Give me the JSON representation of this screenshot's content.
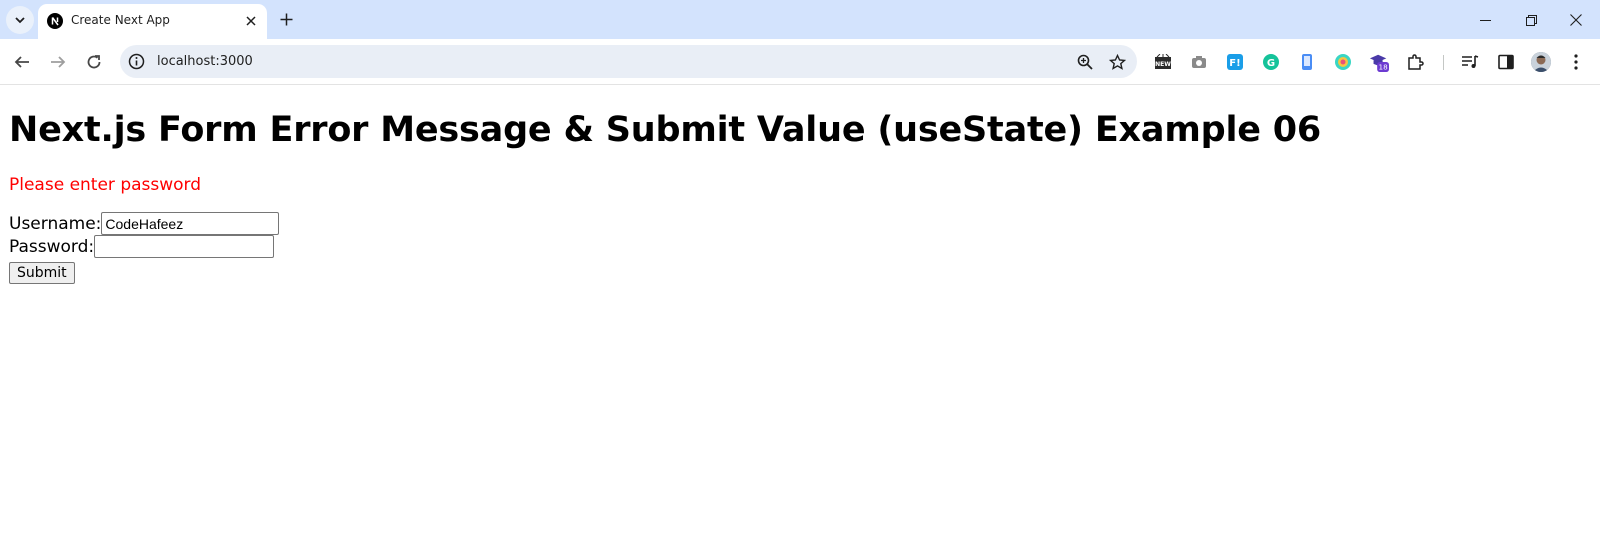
{
  "browser": {
    "tab": {
      "title": "Create Next App"
    },
    "address_bar": {
      "url": "localhost:3000"
    },
    "extensions": {
      "badge_count": "18"
    }
  },
  "page": {
    "heading": "Next.js Form Error Message & Submit Value (useState) Example 06",
    "error_message": "Please enter password",
    "username": {
      "label": "Username:",
      "value": "CodeHafeez"
    },
    "password": {
      "label": "Password:",
      "value": ""
    },
    "submit_label": "Submit"
  },
  "colors": {
    "tabstrip_bg": "#d3e3fd",
    "omnibox_bg": "#e9eef6",
    "error_text": "#ff0000"
  }
}
